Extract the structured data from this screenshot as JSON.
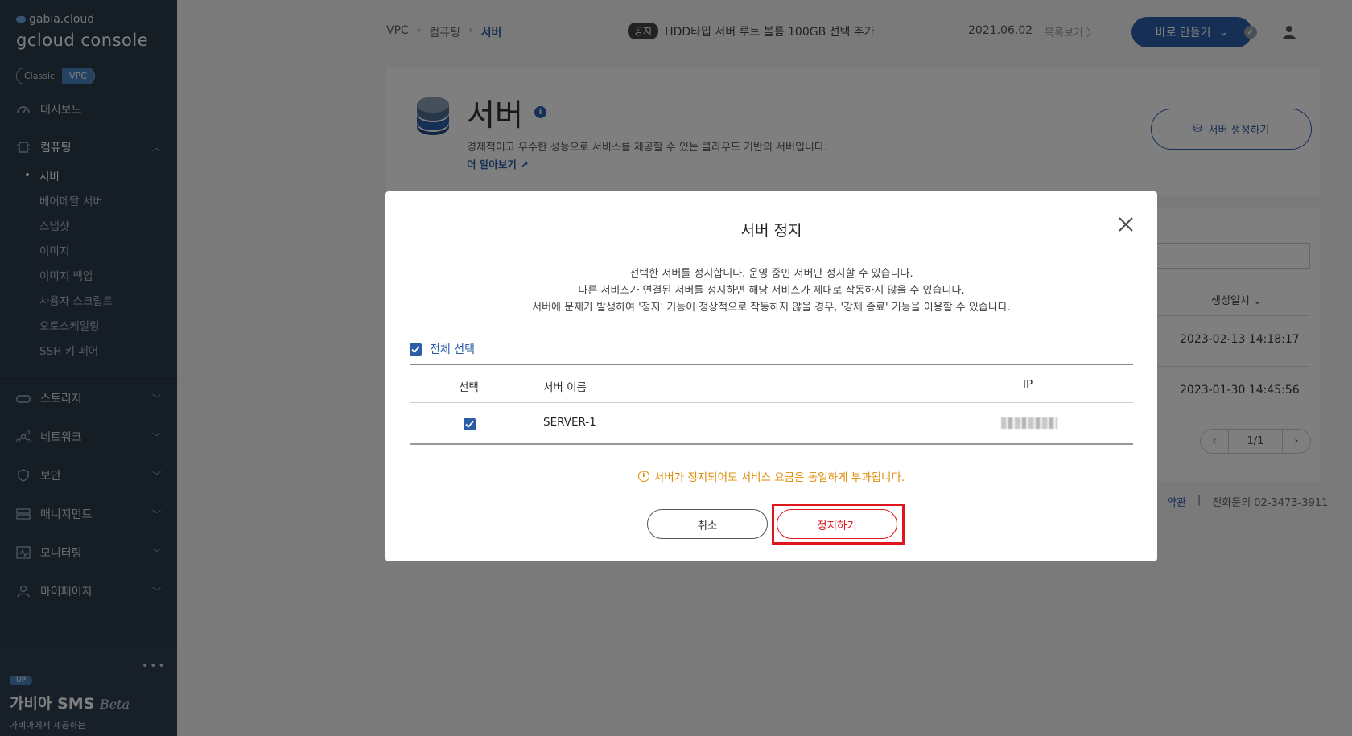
{
  "sidebar": {
    "brand_top": "gabia.cloud",
    "brand_main": "gcloud console",
    "modes": [
      "Classic",
      "VPC"
    ],
    "dashboard": "대시보드",
    "computing": {
      "label": "컴퓨팅",
      "items": [
        "서버",
        "베어메탈 서버",
        "스냅샷",
        "이미지",
        "이미지 백업",
        "사용자 스크립트",
        "오토스케일링",
        "SSH 키 페어"
      ]
    },
    "storage": "스토리지",
    "network": "네트워크",
    "security": "보안",
    "management": "매니지먼트",
    "monitoring": "모니터링",
    "mypage": "마이페이지",
    "promo": {
      "badge": "UP",
      "title": "가비아 SMS",
      "title_suffix": "Beta",
      "subtitle": "가비아에서 제공하는"
    }
  },
  "header": {
    "breadcrumb": [
      "VPC",
      "컴퓨팅",
      "서버"
    ],
    "notice_badge": "공지",
    "notice_text": "HDD타입 서버 루트 볼륨 100GB 선택 추가",
    "notice_date": "2021.06.02",
    "notice_list": "목록보기 〉",
    "quick_create": "바로 만들기"
  },
  "page": {
    "title": "서버",
    "description": "경제적이고 우수한 성능으로 서비스를 제공할 수 있는 클라우드 기반의 서버입니다.",
    "learn_more": "더 알아보기",
    "create_button": "서버 생성하기",
    "table": {
      "created_header": "생성일시",
      "dates": [
        "2023-02-13 14:18:17",
        "2023-01-30 14:45:56"
      ],
      "pager": "1/1"
    },
    "footer": {
      "terms": "약관",
      "phone": "전화문의  02-3473-3911"
    }
  },
  "modal": {
    "title": "서버 정지",
    "desc_lines": [
      "선택한 서버를 정지합니다. 운영 중인 서버만 정지할 수 있습니다.",
      "다른 서비스가 연결된 서버를 정지하면 해당 서비스가 제대로 작동하지 않을 수 있습니다.",
      "서버에 문제가 발생하여 '정지' 기능이 정상적으로 작동하지 않을 경우, '강제 종료' 기능을 이용할 수 있습니다."
    ],
    "select_all": "전체 선택",
    "columns": [
      "선택",
      "서버 이름",
      "IP"
    ],
    "rows": [
      {
        "name": "SERVER-1"
      }
    ],
    "warning": "서버가 정지되어도 서비스 요금은 동일하게 부과됩니다.",
    "cancel": "취소",
    "confirm": "정지하기"
  },
  "colors": {
    "sidebar_bg": "#2b3a4a",
    "accent": "#2c5ea8",
    "warning": "#e08a00",
    "highlight": "#e0161e"
  }
}
